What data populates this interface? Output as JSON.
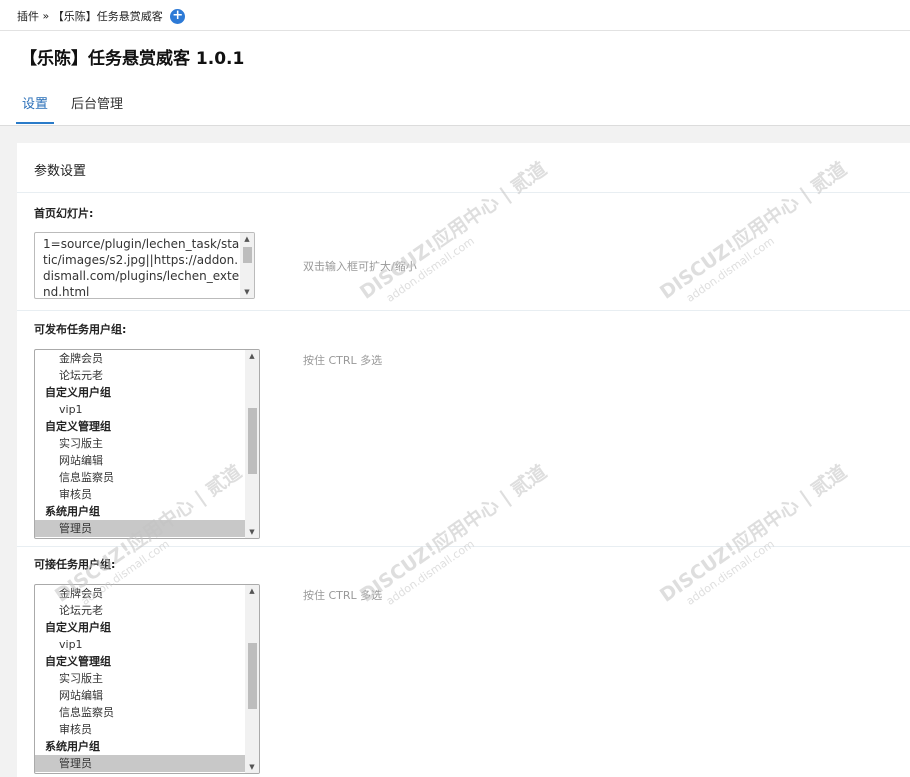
{
  "breadcrumb": {
    "plugins": "插件",
    "separator": "»",
    "current": "【乐陈】任务悬赏威客",
    "add_icon": "plus-circle-icon"
  },
  "header": {
    "title": "【乐陈】任务悬赏威客 1.0.1",
    "tabs": [
      {
        "label": "设置",
        "active": true
      },
      {
        "label": "后台管理",
        "active": false
      }
    ]
  },
  "panel": {
    "title": "参数设置",
    "slideshow": {
      "label": "首页幻灯片:",
      "value": "1=source/plugin/lechen_task/static/images/s2.jpg||https://addon.dismall.com/plugins/lechen_extend.html",
      "tip": "双击输入框可扩大/缩小"
    },
    "publish_groups": {
      "label": "可发布任务用户组:",
      "tip": "按住 CTRL 多选",
      "items": [
        {
          "text": "金牌会员",
          "type": "option"
        },
        {
          "text": "论坛元老",
          "type": "option"
        },
        {
          "text": "自定义用户组",
          "type": "group"
        },
        {
          "text": "vip1",
          "type": "option"
        },
        {
          "text": "自定义管理组",
          "type": "group"
        },
        {
          "text": "实习版主",
          "type": "option"
        },
        {
          "text": "网站编辑",
          "type": "option"
        },
        {
          "text": "信息监察员",
          "type": "option"
        },
        {
          "text": "审核员",
          "type": "option"
        },
        {
          "text": "系统用户组",
          "type": "group"
        },
        {
          "text": "管理员",
          "type": "option",
          "selected": true
        }
      ]
    },
    "accept_groups": {
      "label": "可接任务用户组:",
      "tip": "按住 CTRL 多选",
      "items": [
        {
          "text": "金牌会员",
          "type": "option"
        },
        {
          "text": "论坛元老",
          "type": "option"
        },
        {
          "text": "自定义用户组",
          "type": "group"
        },
        {
          "text": "vip1",
          "type": "option"
        },
        {
          "text": "自定义管理组",
          "type": "group"
        },
        {
          "text": "实习版主",
          "type": "option"
        },
        {
          "text": "网站编辑",
          "type": "option"
        },
        {
          "text": "信息监察员",
          "type": "option"
        },
        {
          "text": "审核员",
          "type": "option"
        },
        {
          "text": "系统用户组",
          "type": "group"
        },
        {
          "text": "管理员",
          "type": "option",
          "selected": true
        }
      ]
    }
  },
  "watermark": {
    "main": "DISCUZ!应用中心 | 贰道",
    "sub": "addon.dismall.com"
  },
  "colors": {
    "accent": "#2a7bc9",
    "plus_button": "#2d7ad6",
    "tip_text": "#999999"
  }
}
